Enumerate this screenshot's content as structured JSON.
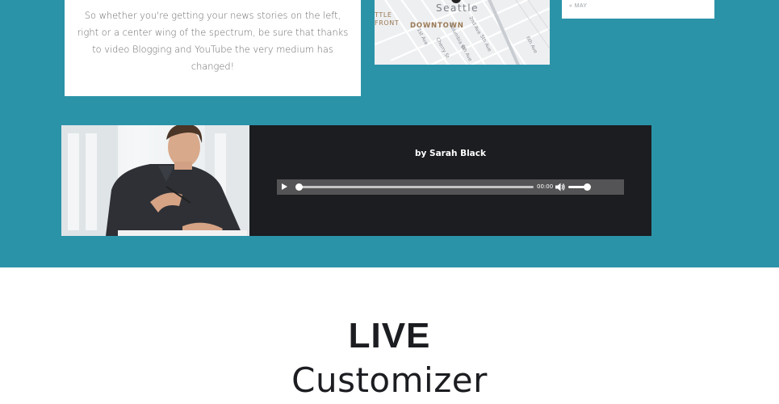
{
  "text_card": {
    "body": "So whether you're getting your news stories on the left, right or a center wing of the spectrum, be sure that thanks to video Blogging and YouTube the very medium has changed!"
  },
  "map": {
    "city": "Seattle",
    "area_left": "TTLE\nFRONT",
    "district": "DOWNTOWN",
    "street_1": "1st Ave",
    "street_2": "2nd Ave",
    "street_3": "Columbia St",
    "street_4": "Cherry St",
    "street_5": "5th Ave",
    "street_6": "6th Ave",
    "street_7": "4th Ave"
  },
  "calendar": {
    "prev_month": "« MAY"
  },
  "audio_post": {
    "author": "by Sarah Black",
    "time": "00:00",
    "progress": 0,
    "volume": 0.8,
    "icons": {
      "play": "play-icon",
      "volume": "volume-icon"
    }
  },
  "hero": {
    "title": "LIVE",
    "subtitle": "Customizer"
  },
  "colors": {
    "accent": "#2b93a8",
    "dark": "#1c1d21"
  }
}
